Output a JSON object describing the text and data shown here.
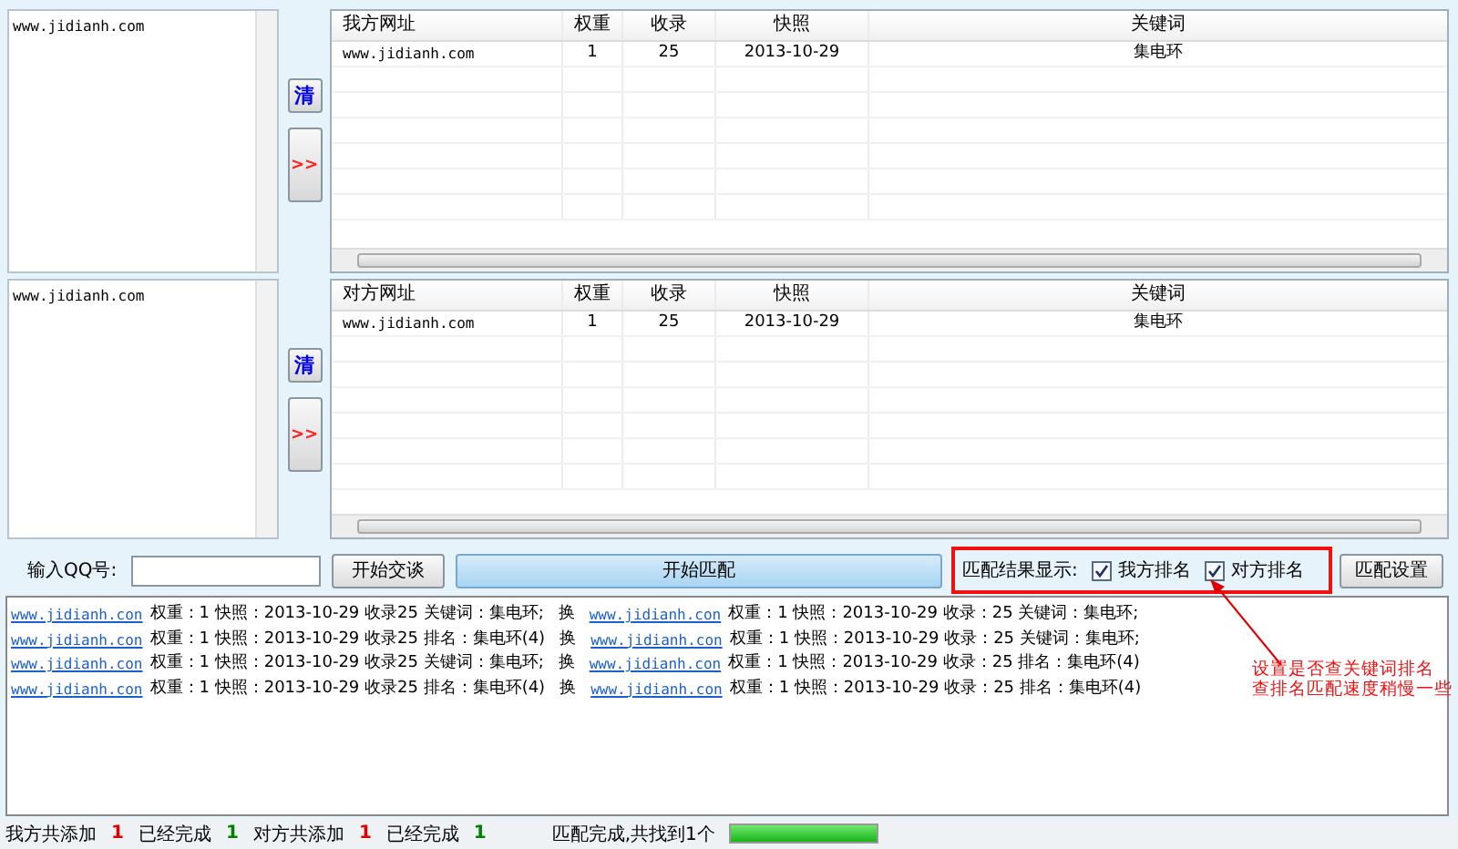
{
  "sections": [
    {
      "input_text": "www.jidianh.com",
      "clear_button": "清",
      "transfer_button": ">>",
      "table": {
        "columns": [
          "我方网址",
          "权重",
          "收录",
          "快照",
          "关键词"
        ],
        "rows": [
          [
            "www.jidianh.com",
            "1",
            "25",
            "2013-10-29",
            "集电环"
          ]
        ]
      }
    },
    {
      "input_text": "www.jidianh.com",
      "clear_button": "清",
      "transfer_button": ">>",
      "table": {
        "columns": [
          "对方网址",
          "权重",
          "收录",
          "快照",
          "关键词"
        ],
        "rows": [
          [
            "www.jidianh.com",
            "1",
            "25",
            "2013-10-29",
            "集电环"
          ]
        ]
      }
    }
  ],
  "qq_label": "输入QQ号:",
  "chat_button": "开始交谈",
  "match_button": "开始匹配",
  "display_label": "匹配结果显示:",
  "options": [
    {
      "label": "我方排名",
      "checked": true
    },
    {
      "label": "对方排名",
      "checked": true
    }
  ],
  "settings_button": "匹配设置",
  "log": [
    {
      "link1": "www.jidianh.con",
      "text1": "权重：1 快照：2013-10-29 收录25 关键词：集电环;",
      "swap": "换",
      "link2": "www.jidianh.con",
      "text2": "权重：1 快照：2013-10-29 收录：25 关键词：集电环;"
    },
    {
      "link1": "www.jidianh.con",
      "text1": "权重：1 快照：2013-10-29 收录25 排名：集电环(4)",
      "swap": "换",
      "link2": "www.jidianh.con",
      "text2": "权重：1 快照：2013-10-29 收录：25 关键词：集电环;"
    },
    {
      "link1": "www.jidianh.con",
      "text1": "权重：1 快照：2013-10-29 收录25 关键词：集电环;",
      "swap": "换",
      "link2": "www.jidianh.con",
      "text2": "权重：1 快照：2013-10-29 收录：25 排名：集电环(4)"
    },
    {
      "link1": "www.jidianh.con",
      "text1": "权重：1 快照：2013-10-29 收录25 排名：集电环(4)",
      "swap": "换",
      "link2": "www.jidianh.con",
      "text2": "权重：1 快照：2013-10-29 收录：25 排名：集电环(4)"
    }
  ],
  "annotation": [
    "设置是否查关键词排名",
    "查排名匹配速度稍慢一些"
  ],
  "status_bar": {
    "items": [
      {
        "label": "我方共添加",
        "count": "1",
        "color": "#e00000"
      },
      {
        "label": "已经完成",
        "count": "1",
        "color": "#008000"
      },
      {
        "label": "对方共添加",
        "count": "1",
        "color": "#e00000"
      },
      {
        "label": "已经完成",
        "count": "1",
        "color": "#008000"
      }
    ],
    "message": "匹配完成,共找到1个",
    "progress": {
      "level": 1
    }
  }
}
